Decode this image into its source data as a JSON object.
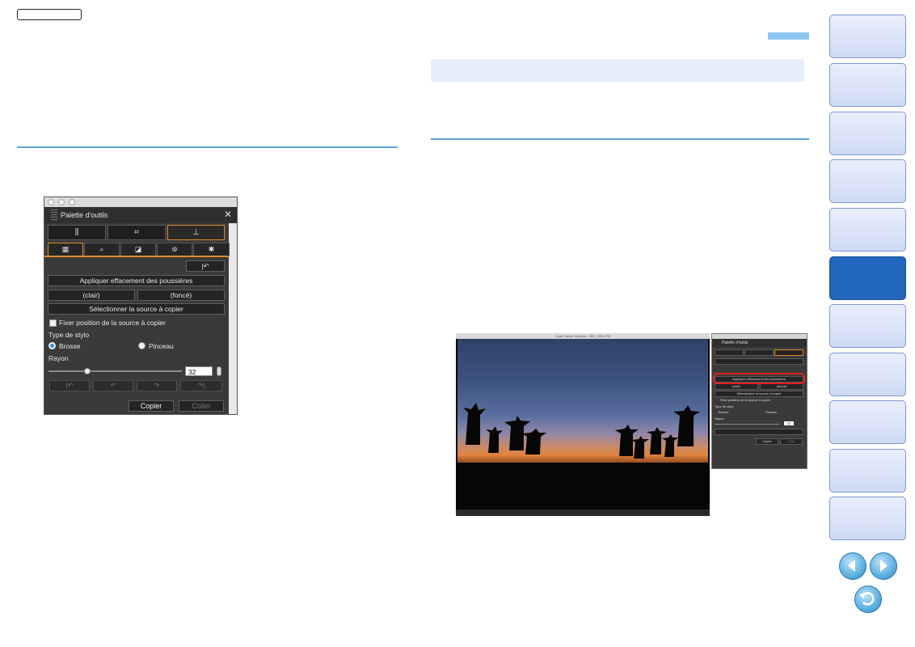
{
  "palette": {
    "title": "Palette d'outils",
    "close_glyph": "✕",
    "tabs": [
      "⫼",
      "⌗",
      "⊥"
    ],
    "subtabs": [
      "▦",
      "⌕",
      "◪",
      "⊛",
      "✱"
    ],
    "undo_top": "|↶",
    "apply_dust": "Appliquer effacement des poussières",
    "clair": "(clair)",
    "fonce": "(foncé)",
    "select_source": "Sélectionner la source à copier",
    "fix_position": "Fixer position de la source à copier",
    "pen_type": "Type de stylo",
    "brush": "Brosse",
    "pencil": "Pinceau",
    "radius": "Rayon",
    "radius_value": "32",
    "radius_level": 0.29,
    "history_buttons": [
      "|↶",
      "↶",
      "↷",
      "↷|"
    ],
    "copy": "Copier",
    "paste": "Coller"
  },
  "screenshot": {
    "title_bar": "Copy Stamp Selection / IMG_006.CR2",
    "status_bar": "",
    "small_palette": {
      "title": "Palette d'outils",
      "apply_dust": "Appliquer effacement des poussières",
      "clair": "(clair)",
      "fonce": "(foncé)",
      "select_source": "Sélectionner la source à copier",
      "fix_position": "Fixer position de la source à copier",
      "pen_type": "Type de stylo",
      "brush": "Brosse",
      "pencil": "Pinceau",
      "radius": "Rayon",
      "radius_value": "32",
      "copy": "Copier",
      "paste": "Coller"
    }
  },
  "colors": {
    "accent_orange": "#e08a2a",
    "nav_active": "#2366be",
    "rule_blue": "#5aa7de",
    "highlight_red": "#e0201e"
  },
  "nav": {
    "tabs": [
      "",
      "",
      "",
      "",
      "",
      "",
      "",
      "",
      "",
      "",
      ""
    ],
    "active_index": 5,
    "prev_icon": "◀",
    "next_icon": "▶",
    "return_icon": "↺"
  }
}
